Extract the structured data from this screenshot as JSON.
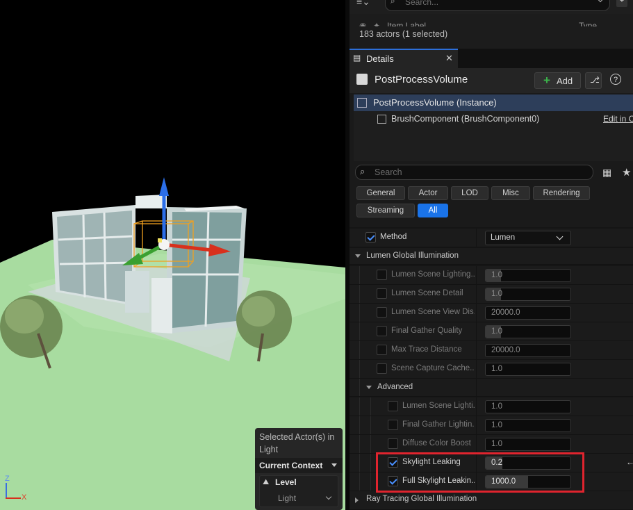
{
  "viewport": {
    "axis_z": "Z",
    "axis_x": "X",
    "context_panel": {
      "selected_label": "Selected Actor(s) in Light",
      "current_context": "Current Context",
      "level_label": "Level",
      "level_value": "Light"
    }
  },
  "outliner": {
    "search_placeholder": "Search...",
    "column_item_label": "Item Label",
    "column_type": "Type",
    "actor_count": "183 actors (1 selected)"
  },
  "details": {
    "tab_label": "Details",
    "actor_name": "PostProcessVolume",
    "add_button": "Add",
    "components": [
      {
        "label": "PostProcessVolume (Instance)"
      },
      {
        "label": "BrushComponent (BrushComponent0)",
        "link": "Edit in C"
      }
    ],
    "search_placeholder": "Search",
    "filters": [
      "General",
      "Actor",
      "LOD",
      "Misc",
      "Rendering",
      "Streaming",
      "All"
    ],
    "active_filter": "All",
    "method": {
      "label": "Method",
      "value": "Lumen"
    },
    "lumen_gi": {
      "title": "Lumen Global Illumination",
      "properties": [
        {
          "label": "Lumen Scene Lighting...",
          "value": "1.0"
        },
        {
          "label": "Lumen Scene Detail",
          "value": "1.0"
        },
        {
          "label": "Lumen Scene View Dis...",
          "value": "20000.0"
        },
        {
          "label": "Final Gather Quality",
          "value": "1.0"
        },
        {
          "label": "Max Trace Distance",
          "value": "20000.0"
        },
        {
          "label": "Scene Capture Cache...",
          "value": "1.0"
        }
      ],
      "advanced": {
        "title": "Advanced",
        "properties": [
          {
            "label": "Lumen Scene Lighti...",
            "value": "1.0"
          },
          {
            "label": "Final Gather Lightin...",
            "value": "1.0"
          },
          {
            "label": "Diffuse Color Boost",
            "value": "1.0"
          },
          {
            "label": "Skylight Leaking",
            "value": "0.2",
            "fill": 0.2
          },
          {
            "label": "Full Skylight Leakin...",
            "value": "1000.0",
            "fill": 0.5
          }
        ]
      }
    },
    "rt_gi": {
      "title": "Ray Tracing Global Illumination"
    }
  },
  "colors": {
    "accent": "#1a73e8",
    "highlight_box": "#e0242e",
    "ground": "#a8dca0",
    "selection": "#2d3e5a"
  }
}
